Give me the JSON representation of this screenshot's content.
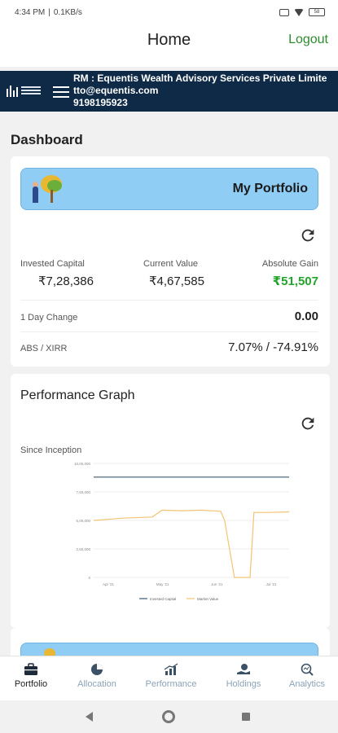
{
  "status_bar": {
    "time": "4:34 PM",
    "network": "0.1KB/s",
    "battery": "58"
  },
  "app_bar": {
    "title": "Home",
    "logout_label": "Logout"
  },
  "rm_banner": {
    "line1": "RM : Equentis Wealth Advisory Services Private Limite",
    "line2": "tto@equentis.com",
    "line3": "9198195923"
  },
  "dashboard": {
    "title": "Dashboard",
    "portfolio": {
      "banner_title": "My Portfolio",
      "invested_label": "Invested Capital",
      "invested_value": "₹7,28,386",
      "current_label": "Current Value",
      "current_value": "₹4,67,585",
      "gain_label": "Absolute Gain",
      "gain_value": "₹51,507",
      "day_change_label": "1 Day Change",
      "day_change_value": "0.00",
      "abs_xirr_label": "ABS / XIRR",
      "abs_xirr_value": "7.07% / -74.91%"
    },
    "performance": {
      "title": "Performance Graph",
      "subtitle": "Since Inception"
    }
  },
  "chart_data": {
    "type": "line",
    "x": [
      "Apr '21",
      "May '21",
      "Jun '21",
      "Jul '21"
    ],
    "ylim": [
      0,
      1000000
    ],
    "yticks": [
      "10,00,000",
      "7,50,000",
      "5,00,000",
      "2,50,000",
      "0"
    ],
    "series": [
      {
        "name": "Invested Capital",
        "color": "#3d5a73",
        "points": [
          [
            0,
            880000
          ],
          [
            0.25,
            880000
          ],
          [
            0.5,
            880000
          ],
          [
            0.75,
            880000
          ],
          [
            1,
            880000
          ]
        ]
      },
      {
        "name": "Market Value",
        "color": "#f3c373",
        "points": [
          [
            0,
            500000
          ],
          [
            0.15,
            520000
          ],
          [
            0.3,
            530000
          ],
          [
            0.35,
            590000
          ],
          [
            0.45,
            585000
          ],
          [
            0.55,
            590000
          ],
          [
            0.65,
            580000
          ],
          [
            0.67,
            500000
          ],
          [
            0.72,
            0
          ],
          [
            0.8,
            0
          ],
          [
            0.82,
            570000
          ],
          [
            0.9,
            570000
          ],
          [
            1,
            575000
          ]
        ]
      }
    ]
  },
  "tabs": [
    {
      "label": "Portfolio",
      "icon": "briefcase-icon",
      "active": true
    },
    {
      "label": "Allocation",
      "icon": "pie-chart-icon",
      "active": false
    },
    {
      "label": "Performance",
      "icon": "trend-chart-icon",
      "active": false
    },
    {
      "label": "Holdings",
      "icon": "hand-coin-icon",
      "active": false
    },
    {
      "label": "Analytics",
      "icon": "magnifier-chart-icon",
      "active": false
    }
  ],
  "colors": {
    "navy": "#0e2a47",
    "green": "#22a32b",
    "banner_blue": "#8fcdf4"
  }
}
